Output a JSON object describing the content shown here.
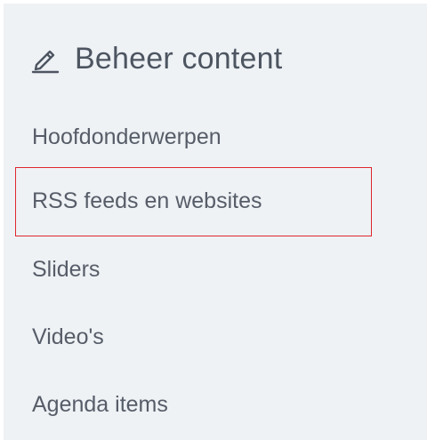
{
  "panel": {
    "title": "Beheer content",
    "title_icon": "pencil-icon",
    "items": [
      {
        "label": "Hoofdonderwerpen"
      },
      {
        "label": "RSS feeds en websites"
      },
      {
        "label": "Sliders"
      },
      {
        "label": "Video's"
      },
      {
        "label": "Agenda items"
      }
    ]
  },
  "colors": {
    "panel_background": "#eef2f5",
    "text": "#575d68",
    "highlight_border": "#e0262f"
  }
}
